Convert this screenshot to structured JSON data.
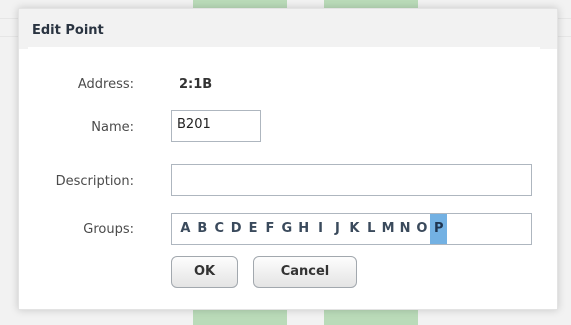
{
  "dialog": {
    "title": "Edit Point",
    "address": {
      "label": "Address:",
      "value": "2:1B"
    },
    "name": {
      "label": "Name:",
      "value": "B201"
    },
    "description": {
      "label": "Description:",
      "value": ""
    },
    "groups": {
      "label": "Groups:",
      "letters": [
        "A",
        "B",
        "C",
        "D",
        "E",
        "F",
        "G",
        "H",
        "I",
        "J",
        "K",
        "L",
        "M",
        "N",
        "O",
        "P"
      ],
      "selected": "P"
    },
    "buttons": {
      "ok": "OK",
      "cancel": "Cancel"
    }
  },
  "colors": {
    "selected_group": "#73b1e3",
    "background_green": "#8cc98a"
  }
}
